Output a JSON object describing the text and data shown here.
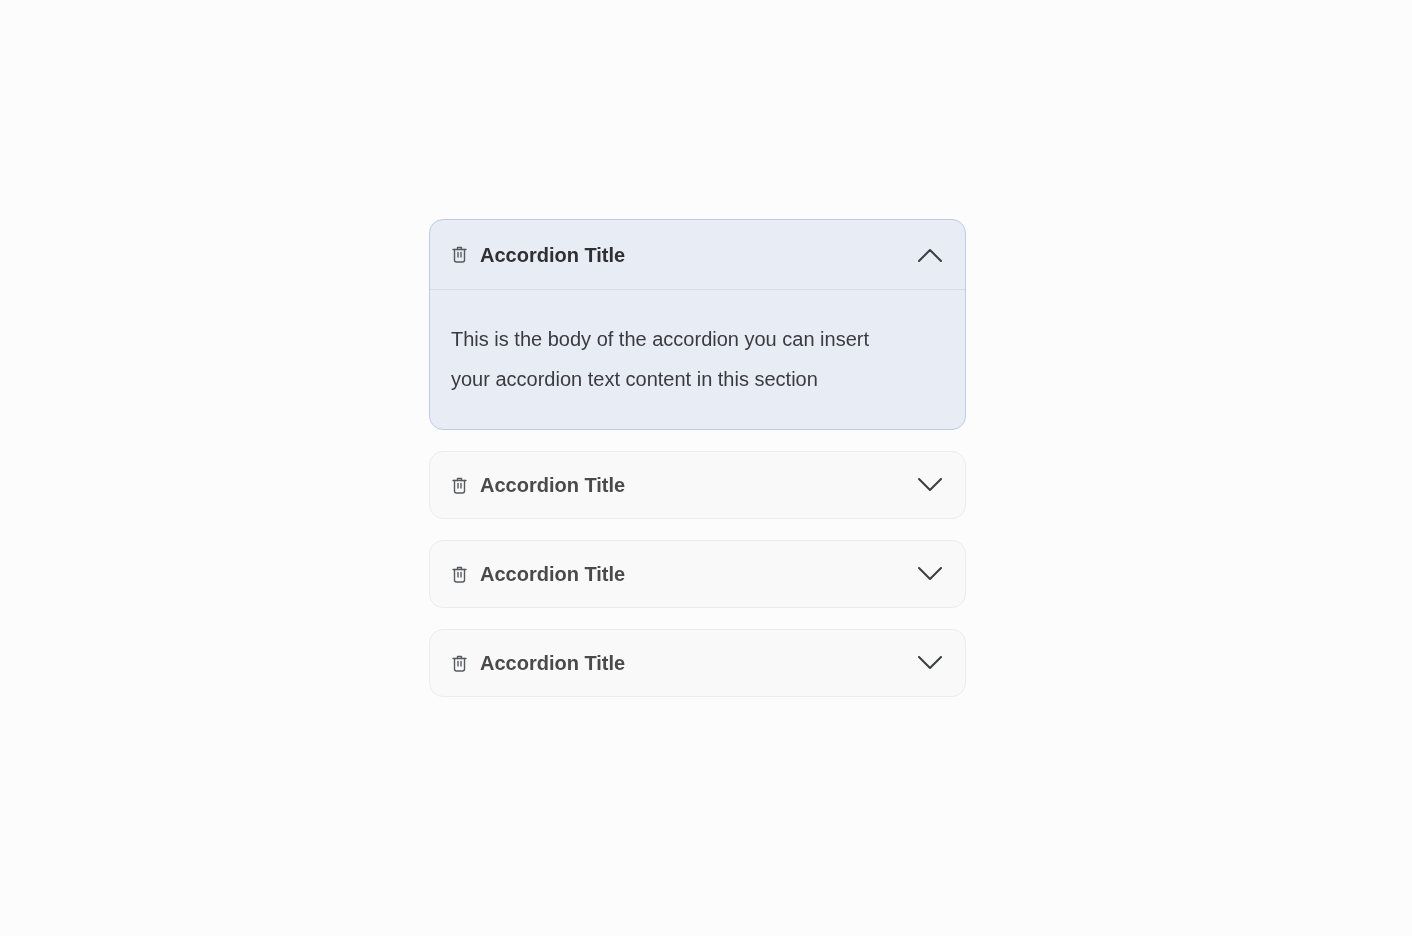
{
  "accordion": {
    "items": [
      {
        "title": "Accordion Title",
        "expanded": true,
        "body": "This is the body of the accordion you can insert your accordion text content in this section"
      },
      {
        "title": "Accordion Title",
        "expanded": false
      },
      {
        "title": "Accordion Title",
        "expanded": false
      },
      {
        "title": "Accordion Title",
        "expanded": false
      }
    ]
  }
}
